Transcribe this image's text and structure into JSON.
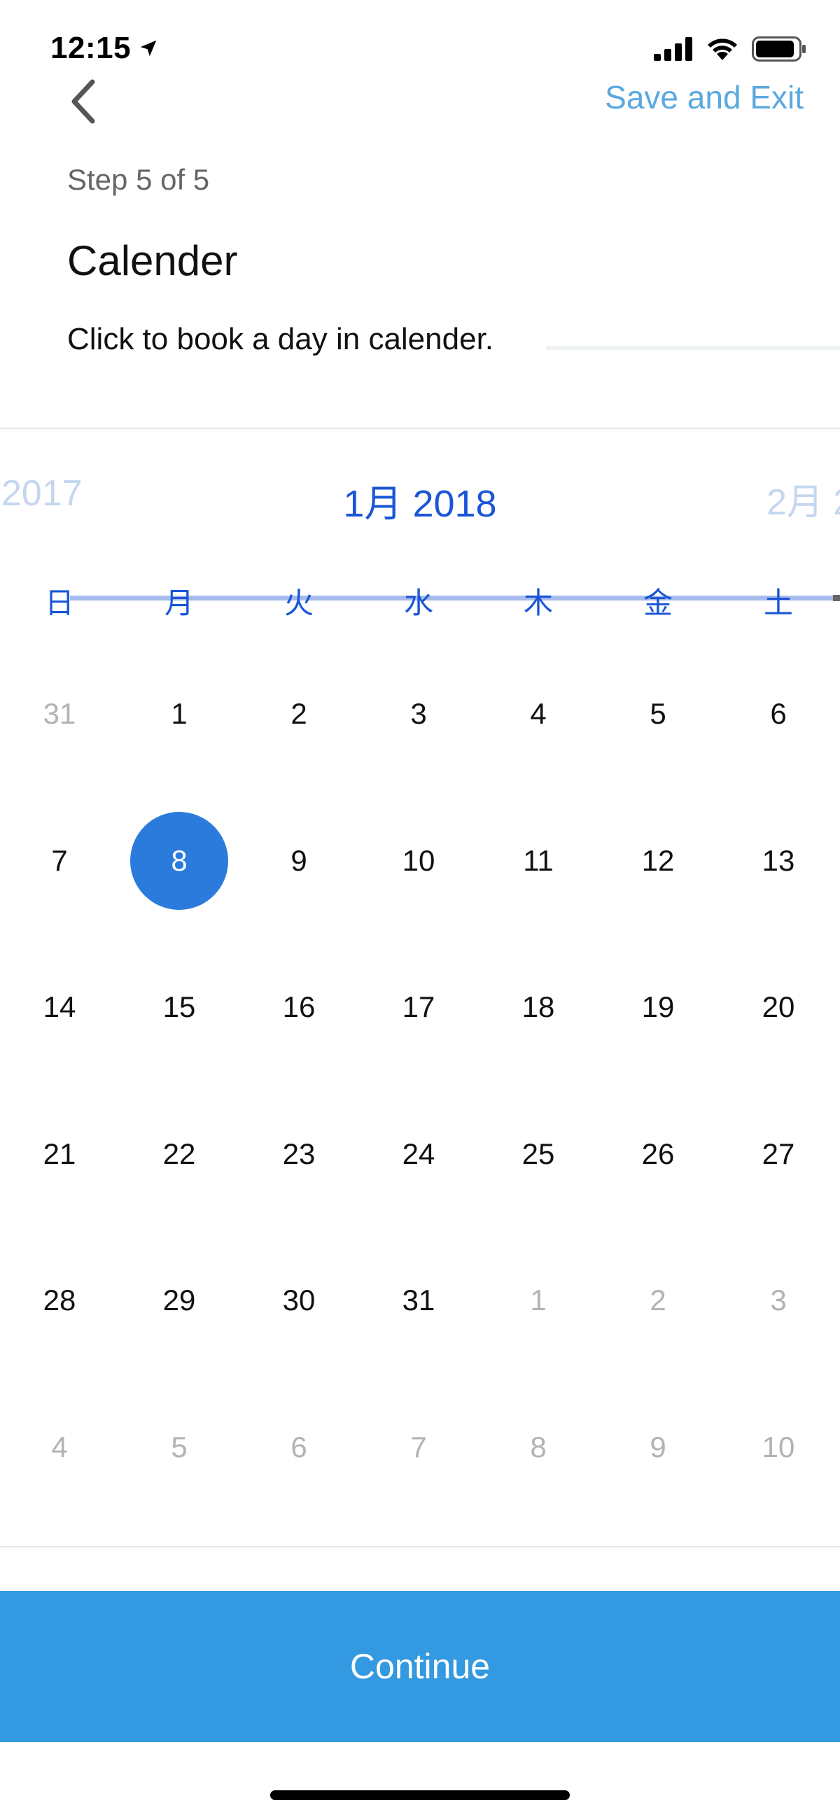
{
  "status_bar": {
    "time": "12:15"
  },
  "nav": {
    "save_exit_label": "Save and Exit"
  },
  "header": {
    "step_label": "Step 5 of 5",
    "title": "Calender",
    "instruction": "Click to book a day in calender."
  },
  "calendar": {
    "prev_month_label": "2017",
    "current_month_label": "1月 2018",
    "next_month_label": "2月 2",
    "weekdays": [
      "日",
      "月",
      "火",
      "水",
      "木",
      "金",
      "土"
    ],
    "weeks": [
      [
        {
          "d": "31",
          "muted": true
        },
        {
          "d": "1"
        },
        {
          "d": "2"
        },
        {
          "d": "3"
        },
        {
          "d": "4"
        },
        {
          "d": "5"
        },
        {
          "d": "6"
        }
      ],
      [
        {
          "d": "7"
        },
        {
          "d": "8",
          "selected": true
        },
        {
          "d": "9"
        },
        {
          "d": "10"
        },
        {
          "d": "11"
        },
        {
          "d": "12"
        },
        {
          "d": "13"
        }
      ],
      [
        {
          "d": "14"
        },
        {
          "d": "15"
        },
        {
          "d": "16"
        },
        {
          "d": "17"
        },
        {
          "d": "18"
        },
        {
          "d": "19"
        },
        {
          "d": "20"
        }
      ],
      [
        {
          "d": "21"
        },
        {
          "d": "22"
        },
        {
          "d": "23"
        },
        {
          "d": "24"
        },
        {
          "d": "25"
        },
        {
          "d": "26"
        },
        {
          "d": "27"
        }
      ],
      [
        {
          "d": "28"
        },
        {
          "d": "29"
        },
        {
          "d": "30"
        },
        {
          "d": "31"
        },
        {
          "d": "1",
          "muted": true
        },
        {
          "d": "2",
          "muted": true
        },
        {
          "d": "3",
          "muted": true
        }
      ],
      [
        {
          "d": "4",
          "muted": true
        },
        {
          "d": "5",
          "muted": true
        },
        {
          "d": "6",
          "muted": true
        },
        {
          "d": "7",
          "muted": true
        },
        {
          "d": "8",
          "muted": true
        },
        {
          "d": "9",
          "muted": true
        },
        {
          "d": "10",
          "muted": true
        }
      ]
    ],
    "selected_day": "8"
  },
  "footer": {
    "continue_label": "Continue"
  },
  "colors": {
    "accent": "#2b7bdc",
    "button": "#3399e0",
    "link": "#5aa9df",
    "month_text": "#1a55d6",
    "muted_text": "#b3b3b3"
  },
  "icons": {
    "location": "location-arrow-icon",
    "signal": "cellular-signal-icon",
    "wifi": "wifi-icon",
    "battery": "battery-icon",
    "back": "chevron-left-icon"
  }
}
